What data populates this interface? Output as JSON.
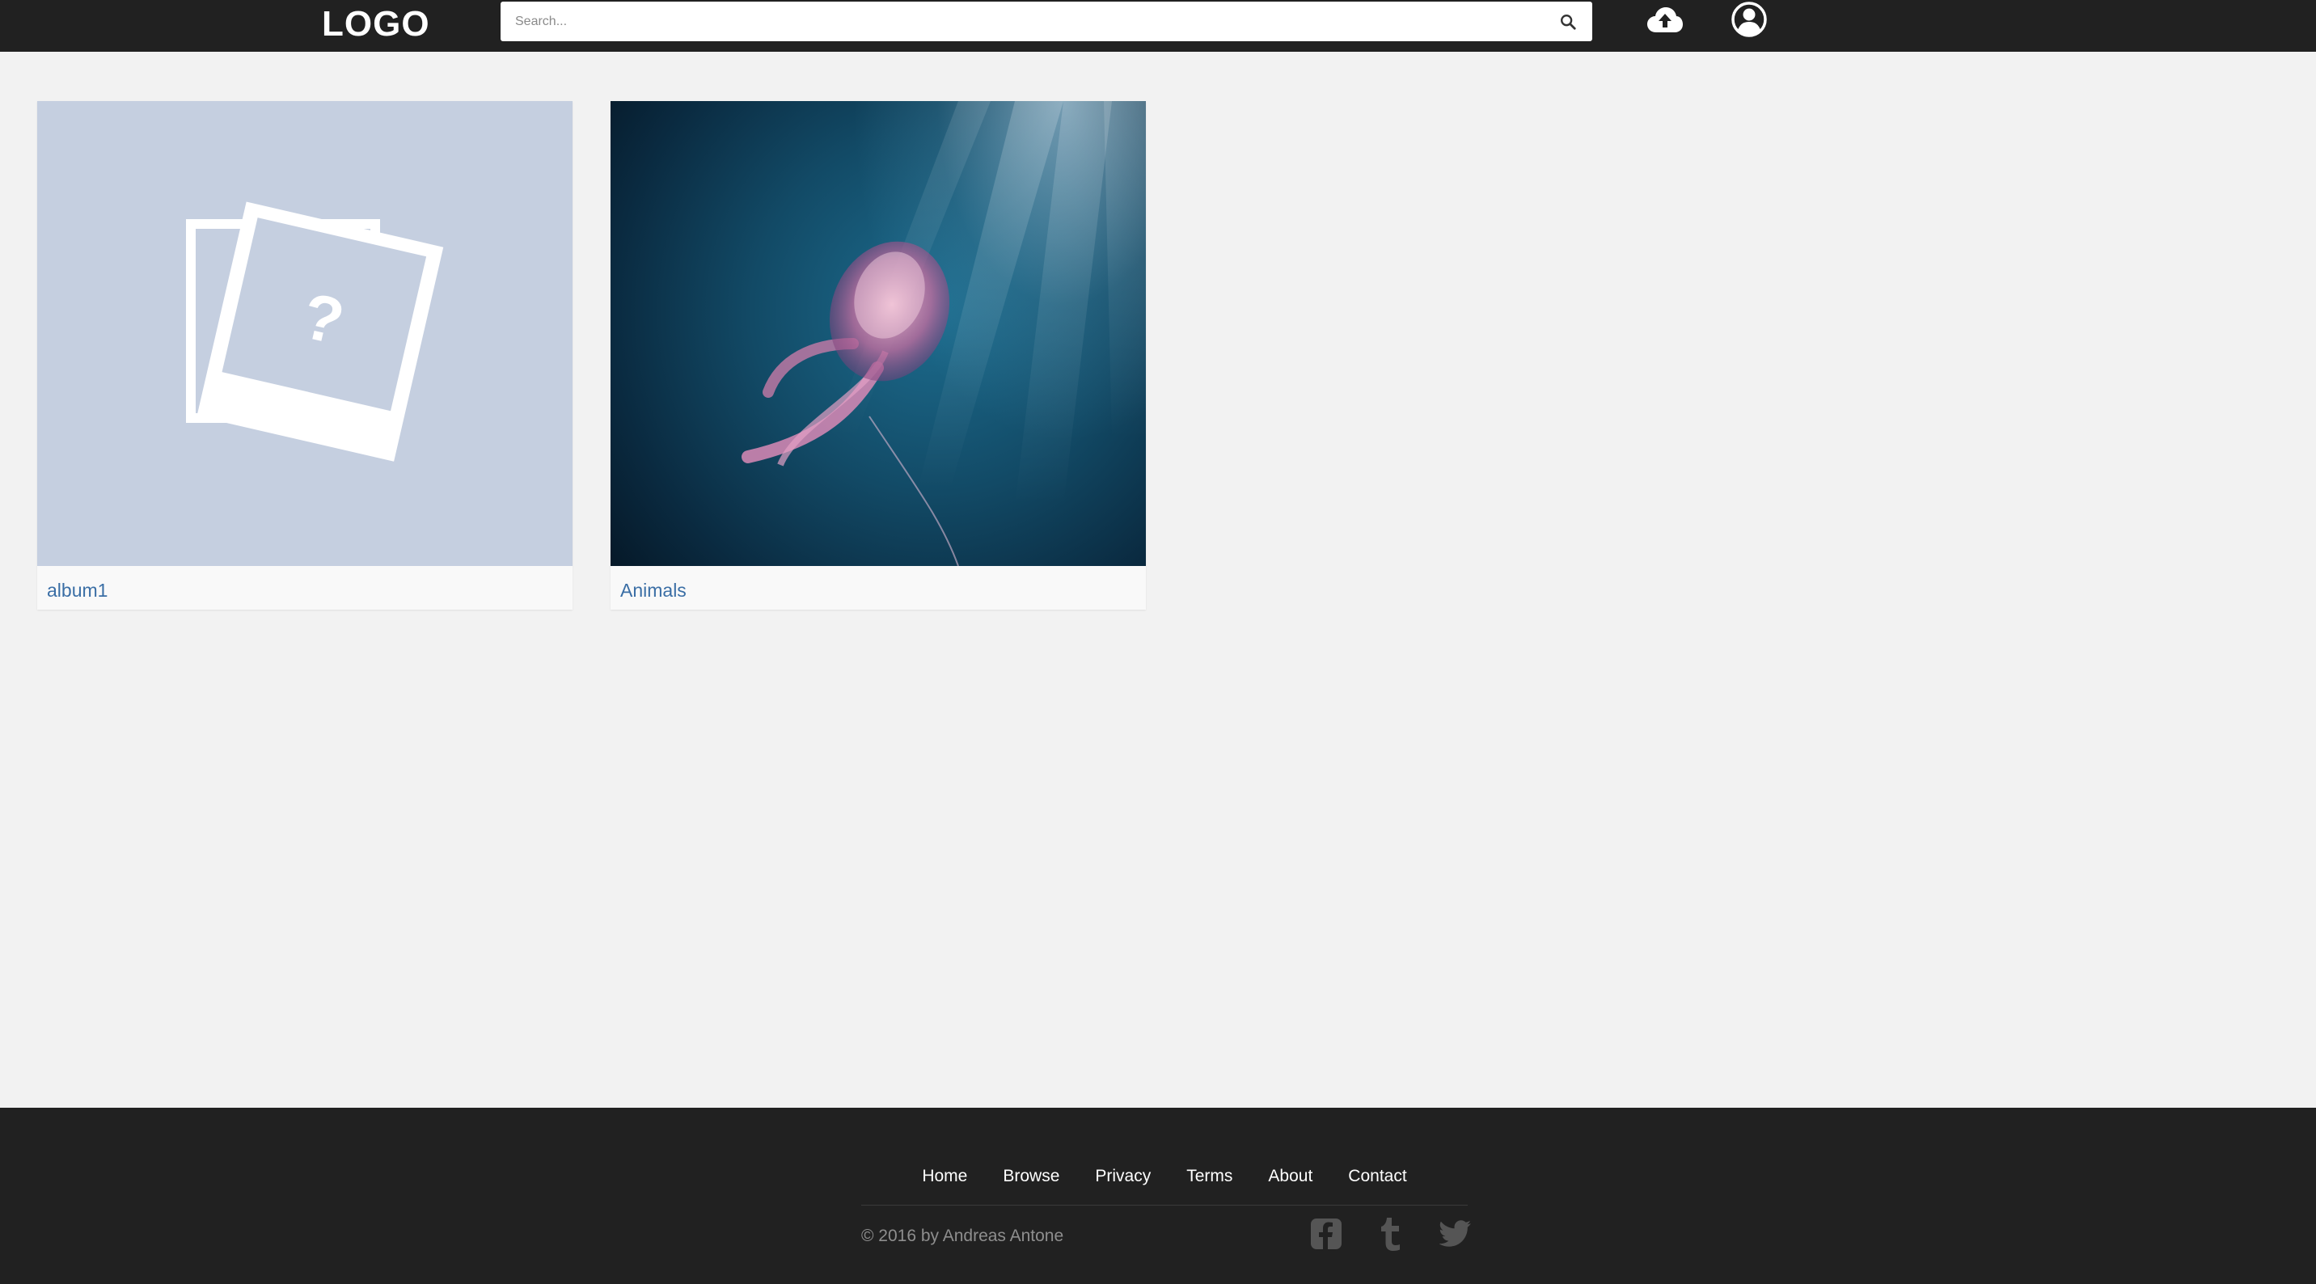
{
  "header": {
    "logo": "LOGO",
    "search": {
      "placeholder": "Search..."
    },
    "icons": {
      "search": "search-icon",
      "upload": "cloud-upload-icon",
      "user": "user-circle-icon"
    }
  },
  "albums": [
    {
      "name": "album1",
      "thumbnail": "placeholder-photo-icon"
    },
    {
      "name": "Animals",
      "thumbnail": "jellyfish-photo"
    }
  ],
  "footer": {
    "nav": [
      "Home",
      "Browse",
      "Privacy",
      "Terms",
      "About",
      "Contact"
    ],
    "copyright": "© 2016 by Andreas Antone",
    "social": [
      "facebook-icon",
      "tumblr-icon",
      "twitter-icon"
    ]
  },
  "colors": {
    "header_bg": "#212121",
    "page_bg": "#f2f2f2",
    "link": "#3a6ea5",
    "placeholder_bg": "#c5cfe0",
    "footer_text": "#8e8e8e"
  }
}
